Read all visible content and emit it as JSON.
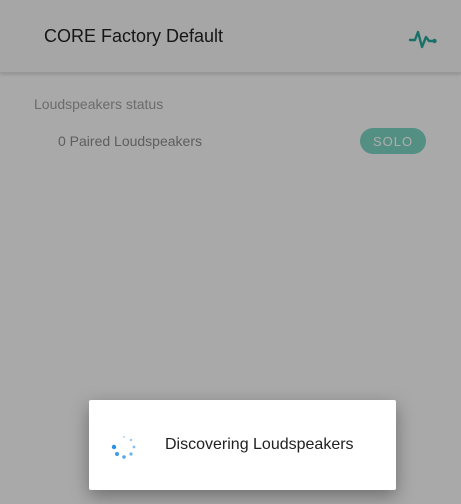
{
  "appbar": {
    "title": "CORE Factory Default",
    "activity_icon": "activity-pulse-icon"
  },
  "section": {
    "title": "Loudspeakers status"
  },
  "speakers": {
    "count_label": "0 Paired Loudspeakers",
    "solo_label": "SOLO"
  },
  "dialog": {
    "message": "Discovering Loudspeakers",
    "spinner_icon": "loading-spinner-icon"
  },
  "colors": {
    "accent": "#26a69a",
    "solo_chip": "#7dd3c3",
    "spinner": "#1e88e5",
    "scrim": "rgba(0,0,0,0.32)"
  }
}
